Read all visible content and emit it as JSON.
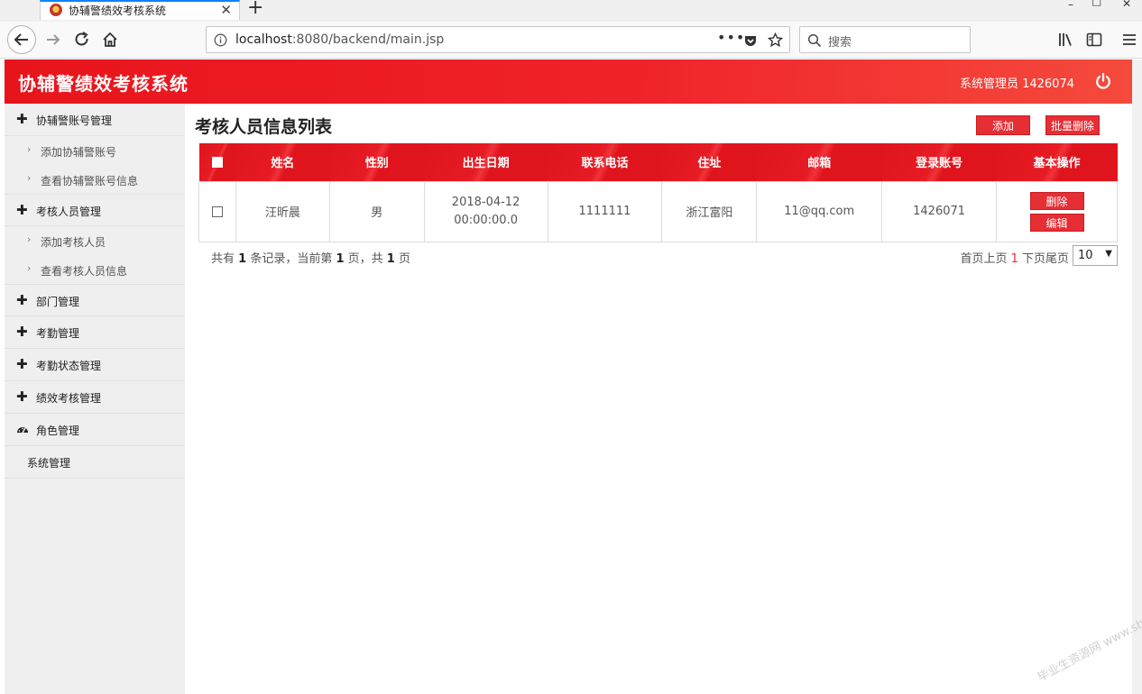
{
  "browser": {
    "tab_title": "协辅警绩效考核系统",
    "url_host": "localhost",
    "url_rest": ":8080/backend/main.jsp",
    "search_placeholder": "搜索"
  },
  "header": {
    "brand": "协辅警绩效考核系统",
    "user": "系统管理员 1426074"
  },
  "sidebar": {
    "sections": [
      {
        "label": "协辅警账号管理",
        "icon": "plus-icon"
      },
      {
        "label": "添加协辅警账号"
      },
      {
        "label": "查看协辅警账号信息"
      },
      {
        "label": "考核人员管理",
        "icon": "plus-icon"
      },
      {
        "label": "添加考核人员"
      },
      {
        "label": "查看考核人员信息"
      },
      {
        "label": "部门管理",
        "icon": "plus-icon"
      },
      {
        "label": "考勤管理",
        "icon": "plus-icon"
      },
      {
        "label": "考勤状态管理",
        "icon": "plus-icon"
      },
      {
        "label": "绩效考核管理",
        "icon": "plus-icon"
      },
      {
        "label": "角色管理",
        "icon": "dashboard-icon"
      },
      {
        "label": "系统管理"
      }
    ]
  },
  "main": {
    "title": "考核人员信息列表",
    "add_label": "添加",
    "batch_delete_label": "批量删除",
    "columns": [
      "姓名",
      "性别",
      "出生日期",
      "联系电话",
      "住址",
      "邮箱",
      "登录账号",
      "基本操作"
    ],
    "rows": [
      {
        "name": "汪昕晨",
        "gender": "男",
        "birth_date": "2018-04-12",
        "birth_time": "00:00:00.0",
        "phone": "1111111",
        "address": "浙江富阳",
        "email": "11@qq.com",
        "account": "1426071",
        "delete_label": "删除",
        "edit_label": "编辑"
      }
    ],
    "pager": {
      "p1": "共有 ",
      "total": "1",
      "p2": " 条记录，当前第 ",
      "current": "1",
      "p3": " 页，共 ",
      "pages": "1",
      "p4": " 页",
      "first_prev": "首页上页 ",
      "page_link": "1",
      "next_last": " 下页尾页",
      "page_size": "10"
    }
  },
  "watermark": "毕业生资源网 www.sbvv.com"
}
